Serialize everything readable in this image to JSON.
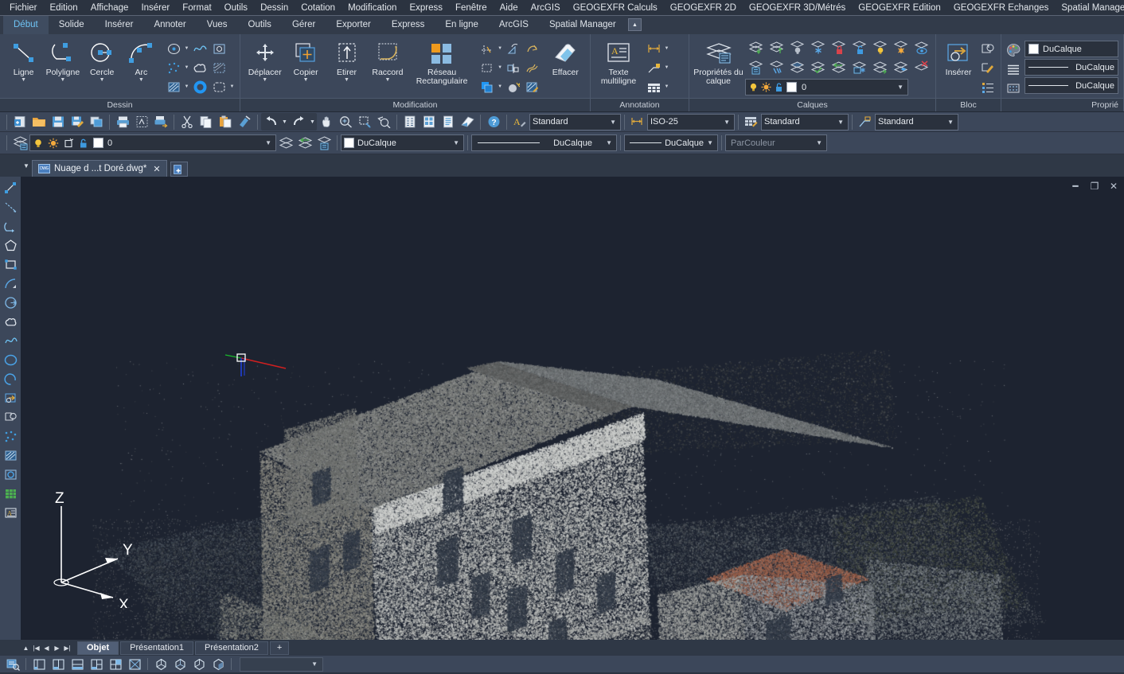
{
  "app": {
    "title": "AutoCAD"
  },
  "menubar": {
    "items": [
      {
        "label": "Fichier"
      },
      {
        "label": "Edition"
      },
      {
        "label": "Affichage"
      },
      {
        "label": "Insérer"
      },
      {
        "label": "Format"
      },
      {
        "label": "Outils"
      },
      {
        "label": "Dessin"
      },
      {
        "label": "Cotation"
      },
      {
        "label": "Modification"
      },
      {
        "label": "Express"
      },
      {
        "label": "Fenêtre"
      },
      {
        "label": "Aide"
      },
      {
        "label": "ArcGIS"
      },
      {
        "label": "GEOGEXFR Calculs"
      },
      {
        "label": "GEOGEXFR 2D"
      },
      {
        "label": "GEOGEXFR 3D/Métrés"
      },
      {
        "label": "GEOGEXFR Edition"
      },
      {
        "label": "GEOGEXFR Echanges"
      },
      {
        "label": "Spatial Manager"
      }
    ]
  },
  "ribbon": {
    "tabs": [
      {
        "label": "Début",
        "active": true
      },
      {
        "label": "Solide",
        "active": false
      },
      {
        "label": "Insérer",
        "active": false
      },
      {
        "label": "Annoter",
        "active": false
      },
      {
        "label": "Vues",
        "active": false
      },
      {
        "label": "Outils",
        "active": false
      },
      {
        "label": "Gérer",
        "active": false
      },
      {
        "label": "Exporter",
        "active": false
      },
      {
        "label": "Express",
        "active": false
      },
      {
        "label": "En ligne",
        "active": false
      },
      {
        "label": "ArcGIS",
        "active": false
      },
      {
        "label": "Spatial Manager",
        "active": false
      }
    ],
    "minimize_icon": "chevron-up-icon",
    "panels": {
      "dessin": {
        "title": "Dessin",
        "buttons": [
          {
            "label": "Ligne",
            "icon": "line-icon"
          },
          {
            "label": "Polyligne",
            "icon": "polyline-icon"
          },
          {
            "label": "Cercle",
            "icon": "circle-icon"
          },
          {
            "label": "Arc",
            "icon": "arc-icon"
          }
        ],
        "small_icons": [
          "ellipse-icon",
          "spline-icon",
          "rectangle-icon",
          "point-icon",
          "revision-cloud-icon",
          "hatch-gradient-icon",
          "hatch-icon",
          "donut-icon",
          "region-icon"
        ]
      },
      "modification": {
        "title": "Modification",
        "buttons": [
          {
            "label": "Déplacer",
            "icon": "move-icon"
          },
          {
            "label": "Copier",
            "icon": "copy-icon"
          },
          {
            "label": "Etirer",
            "icon": "stretch-icon"
          },
          {
            "label": "Raccord",
            "icon": "fillet-icon"
          },
          {
            "label": "Réseau Rectangulaire",
            "icon": "array-rectangular-icon"
          },
          {
            "label": "Effacer",
            "icon": "erase-icon"
          }
        ],
        "small_icons": [
          "trim-icon",
          "scale-icon",
          "rotate-icon",
          "break-icon",
          "mirror-icon",
          "offset-icon",
          "bring-to-front-icon",
          "explode-icon",
          "edit-hatch-icon"
        ]
      },
      "annotation": {
        "title": "Annotation",
        "buttons": [
          {
            "label": "Texte multiligne",
            "icon": "mtext-icon"
          }
        ],
        "small_icons": [
          "dimension-linear-icon",
          "leader-icon",
          "table-icon"
        ]
      },
      "calques": {
        "title": "Calques",
        "buttons": [
          {
            "label": "Propriétés du calque",
            "icon": "layer-properties-icon"
          }
        ],
        "layer_tools_row1": [
          "layer-make-current-icon",
          "layer-match-icon",
          "layer-off-icon",
          "layer-freeze-icon",
          "layer-lock-icon",
          "layer-unlock-icon",
          "layer-turn-on-icon",
          "layer-thaw-all-icon",
          "layer-isolate-icon"
        ],
        "layer_tools_row2": [
          "layer-previous-icon",
          "layer-walk-icon",
          "layer-merge-icon",
          "layer-change-to-current-icon",
          "layer-copy-objects-icon",
          "layer-viewport-freeze-icon",
          "layer-lock-fade-icon",
          "layer-states-icon",
          "layer-delete-icon"
        ],
        "current_layer": {
          "name": "0",
          "swatch_color": "#ffffff",
          "icons": [
            "lightbulb-on-icon",
            "sun-freeze-icon",
            "unlock-icon"
          ]
        }
      },
      "bloc": {
        "title": "Bloc",
        "buttons": [
          {
            "label": "Insérer",
            "icon": "block-insert-icon"
          }
        ],
        "small_icons": [
          "block-create-icon",
          "block-edit-icon",
          "block-attributes-icon"
        ]
      },
      "proprietes": {
        "title": "Proprié",
        "rows": [
          {
            "icon": "color-palette-icon",
            "value": "DuCalque",
            "type": "color",
            "swatch": "#ffffff"
          },
          {
            "icon": "linetype-icon",
            "value": "DuCalque",
            "type": "linetype"
          },
          {
            "icon": "lineweight-icon",
            "value": "DuCalque",
            "type": "lineweight"
          }
        ]
      }
    }
  },
  "toolbar_top": {
    "groups": [
      {
        "icons": [
          "new-file-icon",
          "open-folder-icon",
          "save-icon",
          "save-as-icon",
          "publish-icon"
        ]
      },
      {
        "icons": [
          "plot-icon",
          "plot-preview-icon",
          "plot-to-file-icon"
        ]
      },
      {
        "icons": [
          "cut-icon",
          "copy-clipboard-icon",
          "paste-icon",
          "match-properties-icon"
        ]
      },
      {
        "icons": [
          "undo-icon",
          "undo-dropdown-icon",
          "redo-icon",
          "redo-dropdown-icon",
          "pan-icon",
          "zoom-realtime-icon",
          "zoom-window-icon",
          "zoom-previous-icon"
        ]
      },
      {
        "icons": [
          "properties-palette-icon",
          "designcenter-icon",
          "tool-palettes-icon",
          "sheetset-icon"
        ]
      },
      {
        "icons": [
          "help-icon"
        ]
      }
    ],
    "combos": [
      {
        "icon": "text-style-icon",
        "value": "Standard",
        "name": "text-style-combo"
      },
      {
        "icon": "dim-style-icon",
        "value": "ISO-25",
        "name": "dimension-style-combo"
      },
      {
        "icon": "table-style-icon",
        "value": "Standard",
        "name": "table-style-combo"
      },
      {
        "icon": "mleader-style-icon",
        "value": "Standard",
        "name": "multileader-style-combo"
      }
    ]
  },
  "toolbar_layers": {
    "layer_props_icon": "layer-properties-icon",
    "layer_combo": {
      "value": "0",
      "swatch_color": "#ffffff",
      "state_icons": [
        "lightbulb-on-icon",
        "sun-freeze-icon",
        "new-vp-freeze-icon",
        "unlock-icon"
      ]
    },
    "trailing_icons": [
      "layer-previous-icon",
      "layer-make-current-icon",
      "layer-match-icon"
    ],
    "property_combos": [
      {
        "value": "DuCalque",
        "type": "color",
        "swatch": "#ffffff",
        "name": "color-combo"
      },
      {
        "value": "DuCalque",
        "type": "linetype",
        "name": "linetype-combo"
      },
      {
        "value": "DuCalque",
        "type": "lineweight",
        "name": "lineweight-combo"
      },
      {
        "value": "ParCouleur",
        "type": "plotstyle",
        "dim": true,
        "name": "plotstyle-combo"
      }
    ]
  },
  "document": {
    "tab_label": "Nuage d ...t Doré.dwg*",
    "file_icon": "dwg-file-icon",
    "close_icon": "close-icon",
    "new_tab_icon": "new-tab-icon",
    "menu_icon": "chevron-down-icon"
  },
  "left_toolbar": {
    "icons": [
      "line-icon",
      "construction-line-icon",
      "polyline-arc-icon",
      "polygon-icon",
      "rectangle-icon",
      "arc-icon",
      "circle-icon",
      "revision-cloud-icon",
      "spline-icon",
      "ellipse-icon",
      "ellipse-arc-icon",
      "block-insert-icon",
      "block-create-icon",
      "point-icon",
      "hatch-icon",
      "gradient-icon",
      "table-icon",
      "mtext-icon"
    ]
  },
  "viewport": {
    "window_controls": [
      "minimize-icon",
      "restore-icon",
      "close-icon"
    ],
    "ucs": {
      "x_label": "X",
      "y_label": "Y",
      "z_label": "Z"
    },
    "content_description": "3D point cloud scan of a stone manor house",
    "background_color": "#1d2330"
  },
  "layout_tabs": {
    "nav_icons": [
      "collapse-icon",
      "first-icon",
      "prev-icon",
      "next-icon",
      "last-icon"
    ],
    "tabs": [
      {
        "label": "Objet",
        "active": true
      },
      {
        "label": "Présentation1",
        "active": false
      },
      {
        "label": "Présentation2",
        "active": false
      }
    ],
    "add_label": "+"
  },
  "statusbar": {
    "groups": [
      {
        "icons": [
          "model-space-icon"
        ]
      },
      {
        "icons": [
          "viewport-single-icon",
          "viewport-2v-icon",
          "viewport-2h-icon",
          "viewport-3-icon",
          "viewport-4-icon",
          "viewport-custom-icon"
        ]
      },
      {
        "icons": [
          "visual-style-2dwire-icon",
          "visual-style-3dwire-icon",
          "visual-style-hidden-icon",
          "visual-style-shaded-icon"
        ]
      }
    ],
    "scale_combo": {
      "value": ""
    }
  }
}
